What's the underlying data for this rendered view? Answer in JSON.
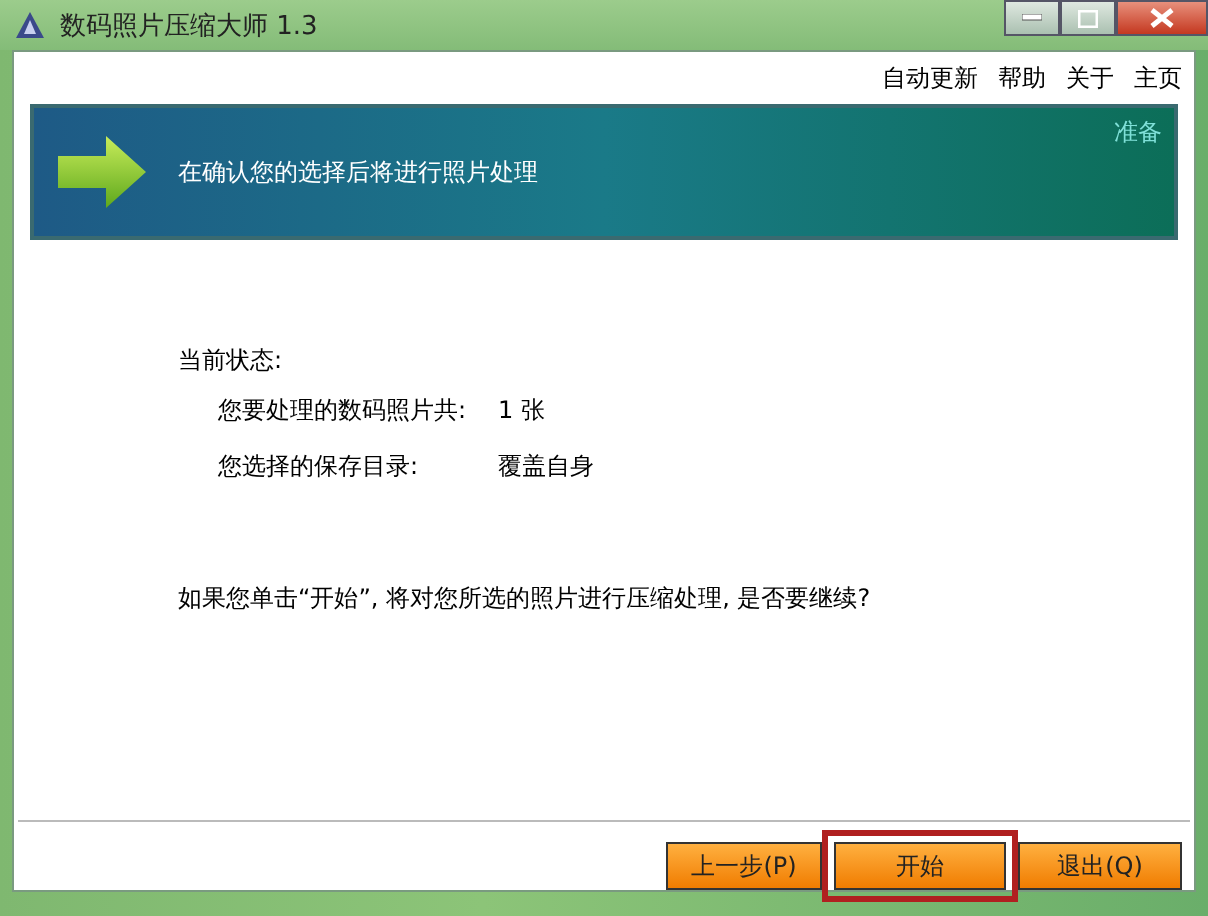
{
  "window": {
    "title": "数码照片压缩大师 1.3"
  },
  "menu": [
    "自动更新",
    "帮助",
    "关于",
    "主页"
  ],
  "banner": {
    "message": "在确认您的选择后将进行照片处理",
    "step": "准备"
  },
  "status": {
    "heading": "当前状态:",
    "rows": [
      {
        "label": "您要处理的数码照片共:",
        "value": "1 张"
      },
      {
        "label": "您选择的保存目录:",
        "value": "覆盖自身"
      }
    ]
  },
  "question": "如果您单击“开始”, 将对您所选的照片进行压缩处理, 是否要继续?",
  "buttons": [
    {
      "label": "上一步(P)",
      "highlighted": false
    },
    {
      "label": "开始",
      "highlighted": true
    },
    {
      "label": "退出(Q)",
      "highlighted": false
    }
  ]
}
